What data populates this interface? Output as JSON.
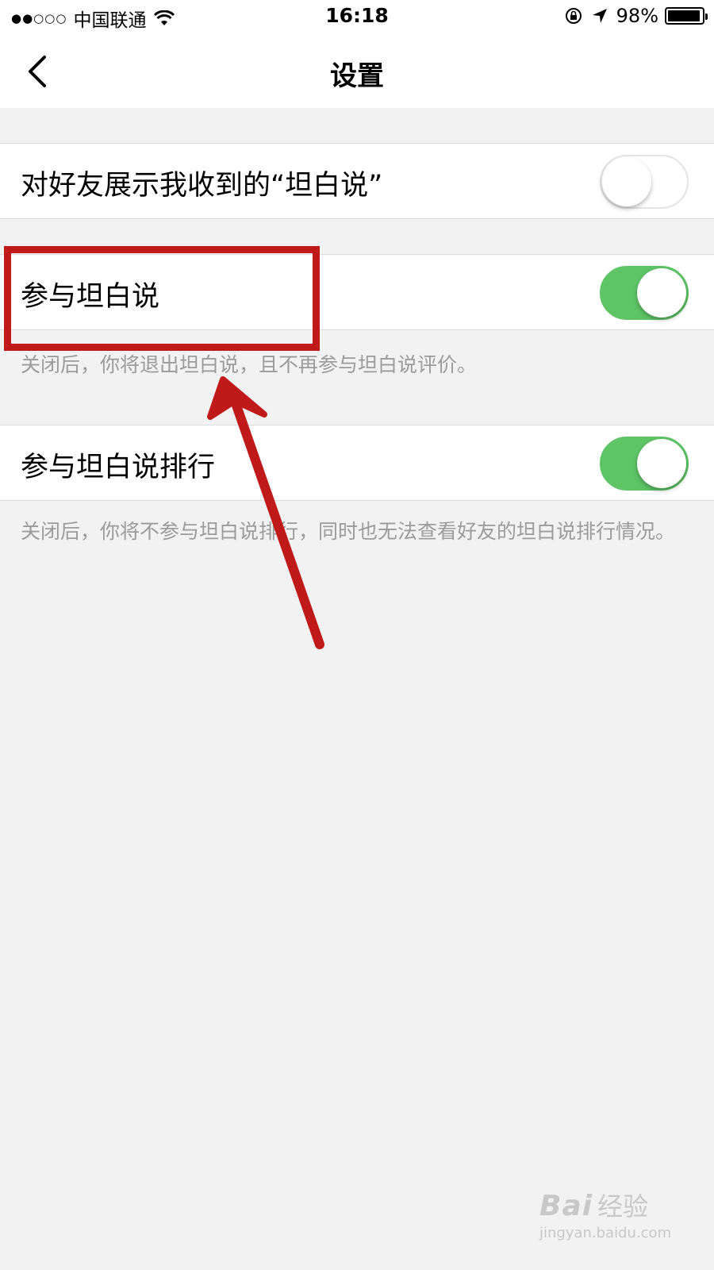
{
  "status_bar": {
    "signal": "●●○○○",
    "carrier": "中国联通",
    "time": "16:18",
    "battery": "98%"
  },
  "nav": {
    "title": "设置"
  },
  "settings": [
    {
      "label": "对好友展示我收到的“坦白说”",
      "toggle": "off"
    },
    {
      "label": "参与坦白说",
      "toggle": "on",
      "description": "关闭后，你将退出坦白说，且不再参与坦白说评价。"
    },
    {
      "label": "参与坦白说排行",
      "toggle": "on",
      "description": "关闭后，你将不参与坦白说排行，同时也无法查看好友的坦白说排行情况。"
    }
  ],
  "colors": {
    "toggle_on": "#5ec466",
    "annotation": "#c0191a"
  },
  "watermark": {
    "brand": "Bai",
    "brand_suffix": "经验",
    "url": "jingyan.baidu.com"
  }
}
